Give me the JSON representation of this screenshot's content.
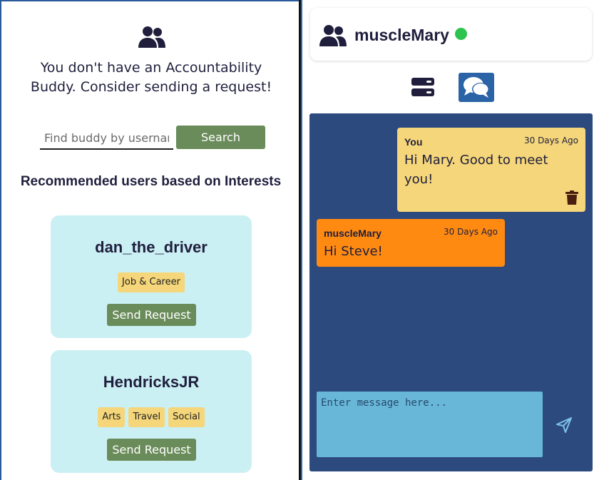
{
  "buddy_panel": {
    "no_buddy_message": "You don't have an Accountability Buddy. Consider sending a request!",
    "search": {
      "placeholder": "Find buddy by username",
      "value": "",
      "button_label": "Search"
    },
    "recommended_title": "Recommended users based on Interests",
    "users": [
      {
        "username": "dan_the_driver",
        "tags": [
          "Job & Career"
        ],
        "button_label": "Send Request"
      },
      {
        "username": "HendricksJR",
        "tags": [
          "Arts",
          "Travel",
          "Social"
        ],
        "button_label": "Send Request"
      }
    ]
  },
  "chat_panel": {
    "header": {
      "username": "muscleMary",
      "status": "online"
    },
    "view_toggle": {
      "active": "chat"
    },
    "messages": [
      {
        "sender": "You",
        "time": "30 Days Ago",
        "text": "Hi Mary. Good to meet you!",
        "deletable": true
      },
      {
        "sender": "muscleMary",
        "time": "30 Days Ago",
        "text": "Hi Steve!",
        "deletable": false
      }
    ],
    "input": {
      "placeholder": "Enter message here...",
      "value": ""
    }
  },
  "colors": {
    "text_dark": "#1f1f3d",
    "button_green": "#6a8c5a",
    "card_bg": "#cbf0f4",
    "tag_bg": "#f5d67a",
    "chat_bg": "#2c4a7e",
    "own_message_bg": "#f5d67a",
    "other_message_bg": "#ff8a12",
    "input_bg": "#68b6d8",
    "online_dot": "#2dc34f",
    "active_toggle": "#2a63a6"
  },
  "icons": {
    "buddy_header": "people-icon",
    "chat_header": "people-icon",
    "list_view": "server-stack-icon",
    "chat_view": "chat-bubbles-icon",
    "delete": "trash-icon",
    "send": "paper-plane-icon"
  }
}
